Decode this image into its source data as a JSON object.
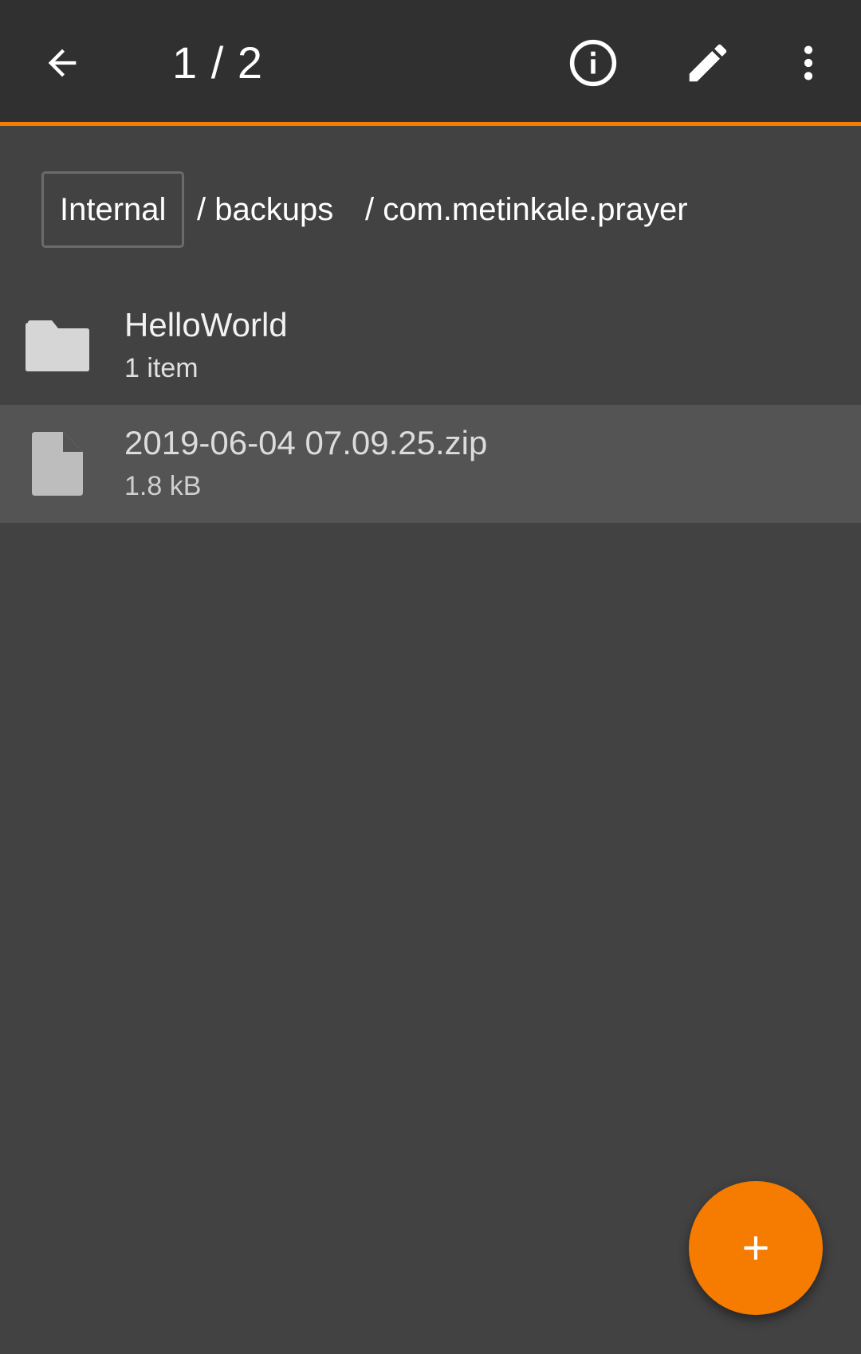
{
  "toolbar": {
    "title": "1 / 2",
    "icons": {
      "back": "arrow-back-icon",
      "info": "info-icon",
      "edit": "pencil-icon",
      "more": "more-vert-icon"
    },
    "accent_color": "#f57c00"
  },
  "breadcrumb": {
    "root": "Internal",
    "segments": [
      "/ backups",
      "/ com.metinkale.prayer"
    ]
  },
  "files": [
    {
      "name": "HelloWorld",
      "detail": "1 item",
      "type": "folder",
      "icon": "folder-icon",
      "selected": false
    },
    {
      "name": "2019-06-04 07.09.25.zip",
      "detail": "1.8 kB",
      "type": "file",
      "icon": "file-icon",
      "selected": true
    }
  ],
  "fab": {
    "icon": "plus-icon",
    "color": "#f57c00"
  }
}
